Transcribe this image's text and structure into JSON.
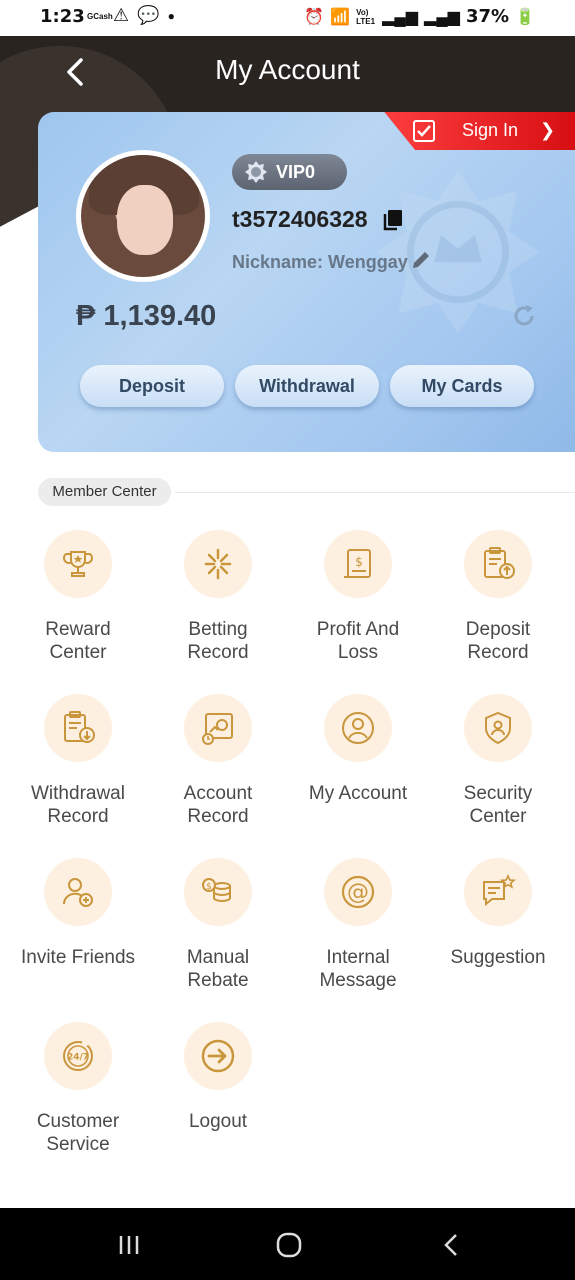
{
  "status": {
    "time": "1:23",
    "gcash": "GCash",
    "battery": "37%",
    "lte": "Vo) LTE1"
  },
  "header": {
    "title": "My Account"
  },
  "card": {
    "sign_in": "Sign In",
    "vip": "VIP0",
    "username": "t3572406328",
    "nickname": "Nickname: Wenggay",
    "balance": "₱ 1,139.40",
    "buttons": {
      "deposit": "Deposit",
      "withdrawal": "Withdrawal",
      "my_cards": "My Cards"
    }
  },
  "member_center": {
    "title": "Member Center",
    "items": [
      {
        "label": "Reward\nCenter",
        "icon": "trophy-icon"
      },
      {
        "label": "Betting\nRecord",
        "icon": "betting-icon"
      },
      {
        "label": "Profit And\nLoss",
        "icon": "profit-loss-icon"
      },
      {
        "label": "Deposit\nRecord",
        "icon": "deposit-record-icon"
      },
      {
        "label": "Withdrawal\nRecord",
        "icon": "withdrawal-record-icon"
      },
      {
        "label": "Account\nRecord",
        "icon": "account-record-icon"
      },
      {
        "label": "My Account",
        "icon": "user-icon"
      },
      {
        "label": "Security\nCenter",
        "icon": "shield-icon"
      },
      {
        "label": "Invite Friends",
        "icon": "invite-icon"
      },
      {
        "label": "Manual\nRebate",
        "icon": "rebate-icon"
      },
      {
        "label": "Internal\nMessage",
        "icon": "at-icon"
      },
      {
        "label": "Suggestion",
        "icon": "suggestion-icon"
      },
      {
        "label": "Customer\nService",
        "icon": "support-24-7-icon"
      },
      {
        "label": "Logout",
        "icon": "logout-icon"
      }
    ]
  },
  "colors": {
    "accent_gold": "#c9963c",
    "icon_bg": "#fdf0e0",
    "sign_in_red": "#e3181b",
    "card_blue": "#a9cbf1"
  }
}
